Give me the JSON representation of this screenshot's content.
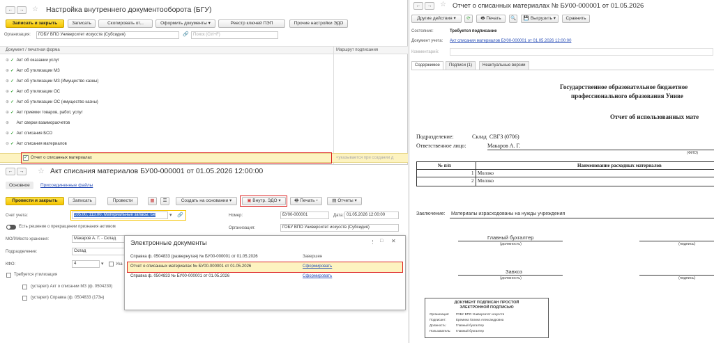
{
  "left_window": {
    "title": "Настройка внутреннего документооборота (БГУ)",
    "toolbar": {
      "save_close": "Записать и закрыть",
      "save": "Записать",
      "copy": "Скопировать от...",
      "design_docs": "Оформить документы",
      "pep_registry": "Реестр ключей ПЭП",
      "other_settings": "Прочие настройки ЭДО"
    },
    "org_label": "Организация:",
    "org_value": "ГОБУ ВПО Университет искусств (Субсидия)",
    "search_placeholder": "Поиск (Ctrl+F)",
    "col_form": "Документ / печатная форма",
    "col_route": "Маршрут подписания",
    "rows": [
      "Акт об оказании услуг",
      "Акт об утилизации МЗ",
      "Акт об утилизации МЗ (Имущество казны)",
      "Акт об утилизации ОС",
      "Акт об утилизации ОС (имущество казны)",
      "Акт приемки товаров, работ, услуг",
      "Акт сверки взаиморасчетов",
      "Акт списания БСО",
      "Акт списания материалов"
    ],
    "selected_row": "Отчет о списанных материалах",
    "route_hint": "<указывается при создании д"
  },
  "act_window": {
    "title": "Акт списания материалов БУ00-000001 от 01.05.2026 12:00:00",
    "tab_main": "Основное",
    "tab_files": "Присоединенные файлы",
    "toolbar": {
      "post_close": "Провести и закрыть",
      "save": "Записать",
      "post": "Провести",
      "create_based": "Создать на основании",
      "edo": "Внутр. ЭДО",
      "print": "Печать",
      "reports": "Отчеты"
    },
    "account_label": "Счет учета:",
    "account_value": "105.00, 113.00, Материальные запасы, Бе",
    "decision_label": "Есть решение о прекращении признания активом",
    "number_label": "Номер:",
    "number_value": "БУ00-000001",
    "date_label": "Дата:",
    "date_value": "01.05.2026 12:00:00",
    "org_label": "Организация:",
    "org_value": "ГОБУ ВПО Университет искусств (Субсидия)",
    "mol_label": "МОЛ/Место хранения:",
    "mol_value": "Макаров А. Г. - Склад",
    "subdivision_label": "Подразделение:",
    "subdivision_value": "Склад",
    "kfo_label": "КФО:",
    "kfo_value": "4",
    "kfo_extra": "Ука",
    "disposal_label": "Требуется утилизация",
    "forms": [
      "(устарел) Акт о списании МЗ (ф. 0504230)",
      "(устарел) Справка (ф. 0504833 (173н)"
    ]
  },
  "edocs_popup": {
    "title": "Электронные документы",
    "rows": [
      {
        "name": "Справка ф. 0504833 (развернутая) № БУ00-000001 от 01.05.2026",
        "status": "Завершен"
      },
      {
        "name": "Отчет о списанных материалах № БУ00-000001 от 01.05.2026",
        "status": "Сформировать"
      },
      {
        "name": "Справка ф. 0504833 № БУ00-000001 от 01.05.2026",
        "status": "Сформировать"
      }
    ]
  },
  "right_window": {
    "title": "Отчет о списанных материалах № БУ00-000001 от 01.05.2026",
    "toolbar": {
      "other_actions": "Другие действия",
      "print": "Печать",
      "upload": "Выгрузить",
      "compare": "Сравнить"
    },
    "state_label": "Состояние:",
    "state_value": "Требуется подписание",
    "acc_doc_label": "Документ учета:",
    "acc_doc_value": "Акт списания материалов БУ00-000001 от 01.05.2026 12:00:00",
    "comment_label": "Комментарий:",
    "tabs": [
      "Содержимое",
      "Подписи (1)",
      "Неактуальные версии"
    ],
    "doc": {
      "header_line1": "Государственное образовательное бюджетное",
      "header_line2": "профессионального образования Униве",
      "report_title": "Отчет об использованных мате",
      "subdivision_label": "Подразделение:",
      "subdivision_value": "Склад  СВГЗ (0706)",
      "responsible_label": "Ответственное лицо:",
      "responsible_value": "Макаров А. Г.",
      "fio": "(ФИО)",
      "table_headers": [
        "№ п/п",
        "Наименование расходных материалов"
      ],
      "table_rows": [
        {
          "n": "1",
          "name": "Молоко"
        },
        {
          "n": "2",
          "name": "Молоко"
        }
      ],
      "conclusion_label": "Заключение:",
      "conclusion_value": "Материалы израсходованы на нужды учреждения",
      "sign1_role": "Главный бухгалтер",
      "sign_position": "(должность)",
      "sign_signature": "(подпись)",
      "sign2_role": "Завхоз",
      "stamp_title1": "ДОКУМЕНТ ПОДПИСАН ПРОСТОЙ",
      "stamp_title2": "ЭЛЕКТРОННОЙ ПОДПИСЬЮ",
      "stamp_rows": [
        {
          "k": "Организация:",
          "v": "ГОБУ ВПО Университет искусств"
        },
        {
          "k": "Подписант:",
          "v": "Еремина Галина Александровна"
        },
        {
          "k": "Должность:",
          "v": "Главный бухгалтер"
        },
        {
          "k": "Пользователь:",
          "v": "Главный бухгалтер"
        }
      ]
    }
  },
  "colors": {
    "accent_yellow": "#f5c400",
    "highlight_red": "#dd2222",
    "selected_row": "#fdf3c0",
    "link": "#2b50b8",
    "check_green": "#2e9e2e"
  }
}
